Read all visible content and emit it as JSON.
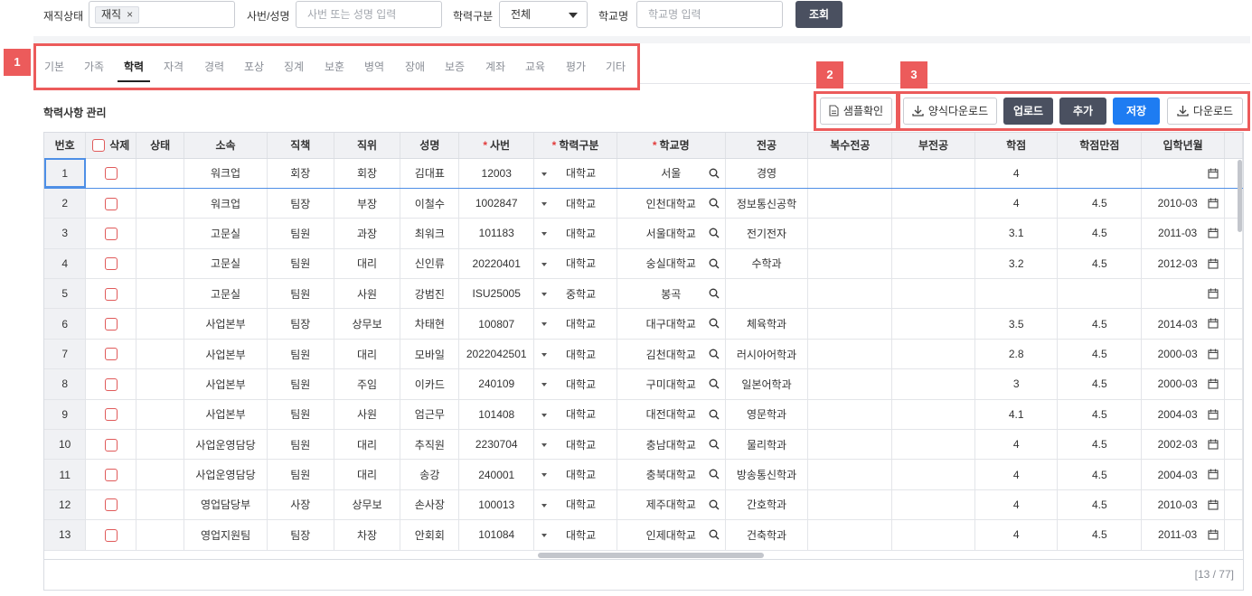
{
  "filters": {
    "status_label": "재직상태",
    "status_chip": "재직",
    "status_chip_remove": "×",
    "emp_label": "사번/성명",
    "emp_placeholder": "사번 또는 성명 입력",
    "edu_type_label": "학력구분",
    "edu_type_value": "전체",
    "school_label": "학교명",
    "school_placeholder": "학교명 입력",
    "search_button": "조회"
  },
  "tabs": [
    {
      "label": "기본"
    },
    {
      "label": "가족"
    },
    {
      "label": "학력",
      "active": true
    },
    {
      "label": "자격"
    },
    {
      "label": "경력"
    },
    {
      "label": "포상"
    },
    {
      "label": "징계"
    },
    {
      "label": "보훈"
    },
    {
      "label": "병역"
    },
    {
      "label": "장애"
    },
    {
      "label": "보증"
    },
    {
      "label": "계좌"
    },
    {
      "label": "교육"
    },
    {
      "label": "평가"
    },
    {
      "label": "기타"
    }
  ],
  "badges": [
    "1",
    "2",
    "3"
  ],
  "section_title": "학력사항 관리",
  "actions": {
    "sample": "샘플확인",
    "template_download": "양식다운로드",
    "upload": "업로드",
    "add": "추가",
    "save": "저장",
    "download": "다운로드"
  },
  "colors": {
    "highlight": "#ec5b5b",
    "dark_button": "#4a5060",
    "primary": "#1e7cf2",
    "selected_row": "#4e8fe6"
  },
  "table": {
    "required_mark": "*",
    "headers": [
      "번호",
      "삭제",
      "상태",
      "소속",
      "직책",
      "직위",
      "성명",
      "사번",
      "학력구분",
      "학교명",
      "전공",
      "복수전공",
      "부전공",
      "학점",
      "학점만점",
      "입학년월"
    ],
    "required_headers": [
      false,
      false,
      false,
      false,
      false,
      false,
      false,
      true,
      true,
      true,
      false,
      false,
      false,
      false,
      false,
      false
    ],
    "rows": [
      {
        "no": "1",
        "status": "",
        "dept": "워크업",
        "title": "회장",
        "rank": "회장",
        "name": "김대표",
        "empno": "12003",
        "edu": "대학교",
        "school": "서울",
        "major": "경영",
        "double_major": "",
        "minor": "",
        "credit": "4",
        "credit_max": "",
        "admission": ""
      },
      {
        "no": "2",
        "status": "",
        "dept": "워크업",
        "title": "팀장",
        "rank": "부장",
        "name": "이철수",
        "empno": "1002847",
        "edu": "대학교",
        "school": "인천대학교",
        "major": "정보통신공학",
        "double_major": "",
        "minor": "",
        "credit": "4",
        "credit_max": "4.5",
        "admission": "2010-03"
      },
      {
        "no": "3",
        "status": "",
        "dept": "고문실",
        "title": "팀원",
        "rank": "과장",
        "name": "최워크",
        "empno": "101183",
        "edu": "대학교",
        "school": "서울대학교",
        "major": "전기전자",
        "double_major": "",
        "minor": "",
        "credit": "3.1",
        "credit_max": "4.5",
        "admission": "2011-03"
      },
      {
        "no": "4",
        "status": "",
        "dept": "고문실",
        "title": "팀원",
        "rank": "대리",
        "name": "신인류",
        "empno": "20220401",
        "edu": "대학교",
        "school": "숭실대학교",
        "major": "수학과",
        "double_major": "",
        "minor": "",
        "credit": "3.2",
        "credit_max": "4.5",
        "admission": "2012-03"
      },
      {
        "no": "5",
        "status": "",
        "dept": "고문실",
        "title": "팀원",
        "rank": "사원",
        "name": "강범진",
        "empno": "ISU25005",
        "edu": "중학교",
        "school": "봉곡",
        "major": "",
        "double_major": "",
        "minor": "",
        "credit": "",
        "credit_max": "",
        "admission": ""
      },
      {
        "no": "6",
        "status": "",
        "dept": "사업본부",
        "title": "팀장",
        "rank": "상무보",
        "name": "차태현",
        "empno": "100807",
        "edu": "대학교",
        "school": "대구대학교",
        "major": "체육학과",
        "double_major": "",
        "minor": "",
        "credit": "3.5",
        "credit_max": "4.5",
        "admission": "2014-03"
      },
      {
        "no": "7",
        "status": "",
        "dept": "사업본부",
        "title": "팀원",
        "rank": "대리",
        "name": "모바일",
        "empno": "2022042501",
        "edu": "대학교",
        "school": "김천대학교",
        "major": "러시아어학과",
        "double_major": "",
        "minor": "",
        "credit": "2.8",
        "credit_max": "4.5",
        "admission": "2000-03"
      },
      {
        "no": "8",
        "status": "",
        "dept": "사업본부",
        "title": "팀원",
        "rank": "주임",
        "name": "이카드",
        "empno": "240109",
        "edu": "대학교",
        "school": "구미대학교",
        "major": "일본어학과",
        "double_major": "",
        "minor": "",
        "credit": "3",
        "credit_max": "4.5",
        "admission": "2000-03"
      },
      {
        "no": "9",
        "status": "",
        "dept": "사업본부",
        "title": "팀원",
        "rank": "사원",
        "name": "엄근무",
        "empno": "101408",
        "edu": "대학교",
        "school": "대전대학교",
        "major": "영문학과",
        "double_major": "",
        "minor": "",
        "credit": "4.1",
        "credit_max": "4.5",
        "admission": "2004-03"
      },
      {
        "no": "10",
        "status": "",
        "dept": "사업운영담당",
        "title": "팀원",
        "rank": "대리",
        "name": "추직원",
        "empno": "2230704",
        "edu": "대학교",
        "school": "충남대학교",
        "major": "물리학과",
        "double_major": "",
        "minor": "",
        "credit": "4",
        "credit_max": "4.5",
        "admission": "2002-03"
      },
      {
        "no": "11",
        "status": "",
        "dept": "사업운영담당",
        "title": "팀원",
        "rank": "대리",
        "name": "송강",
        "empno": "240001",
        "edu": "대학교",
        "school": "충북대학교",
        "major": "방송통신학과",
        "double_major": "",
        "minor": "",
        "credit": "4",
        "credit_max": "4.5",
        "admission": "2004-03"
      },
      {
        "no": "12",
        "status": "",
        "dept": "영업담당부",
        "title": "사장",
        "rank": "상무보",
        "name": "손사장",
        "empno": "100013",
        "edu": "대학교",
        "school": "제주대학교",
        "major": "간호학과",
        "double_major": "",
        "minor": "",
        "credit": "4",
        "credit_max": "4.5",
        "admission": "2010-03"
      },
      {
        "no": "13",
        "status": "",
        "dept": "영업지원팀",
        "title": "팀장",
        "rank": "차장",
        "name": "안회회",
        "empno": "101084",
        "edu": "대학교",
        "school": "인제대학교",
        "major": "건축학과",
        "double_major": "",
        "minor": "",
        "credit": "4",
        "credit_max": "4.5",
        "admission": "2011-03"
      }
    ]
  },
  "pagination": "[13 / 77]"
}
